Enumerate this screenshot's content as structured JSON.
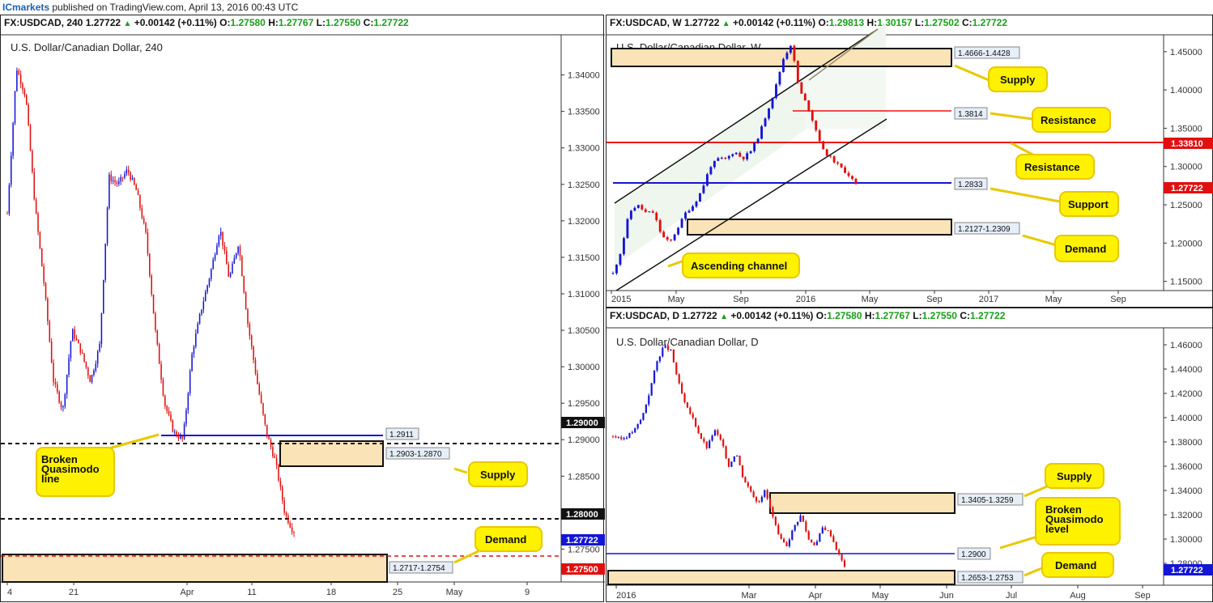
{
  "header": {
    "brand": "ICmarkets",
    "text": "published on TradingView.com, April 13, 2016 00:43 UTC"
  },
  "colors": {
    "bull": "#1515d6",
    "bear": "#e01010",
    "zone": "#fbe3b8",
    "callout": "#fff200",
    "trend": "#111111",
    "support_line": "#1515d6",
    "resistance_line": "#ee1111",
    "channel_fill": "#eef6ee"
  },
  "panels": {
    "h4": {
      "symbol": "FX:USDCAD, 240",
      "last": "1.27722",
      "change": "+0.00142 (+0.11%)",
      "o_label": "O:",
      "o": "1.27580",
      "h_label": "H:",
      "h": "1.27767",
      "l_label": "L:",
      "l": "1.27550",
      "c_label": "C:",
      "c": "1.27722",
      "subtitle": "U.S. Dollar/Canadian Dollar, 240",
      "price_axis": [
        "1.34000",
        "1.33500",
        "1.33000",
        "1.32500",
        "1.32000",
        "1.31500",
        "1.31000",
        "1.30500",
        "1.30000",
        "1.29500",
        "1.29000",
        "1.28500",
        "1.28000",
        "1.27500"
      ],
      "time_axis": [
        "4",
        "21",
        "Apr",
        "11",
        "18",
        "25",
        "May",
        "9"
      ],
      "price_tags": [
        "1.29000",
        "1.28000",
        "1.27722",
        "1.27500"
      ],
      "level_labels": [
        "1.2911",
        "1.2903-1.2870",
        "1.2717-1.2754"
      ],
      "callouts": [
        "Broken Quasimodo line",
        "Supply",
        "Demand"
      ]
    },
    "weekly": {
      "symbol": "FX:USDCAD, W",
      "last": "1.27722",
      "change": "+0.00142 (+0.11%)",
      "o_label": "O:",
      "o": "1.29813",
      "h_label": "H:",
      "h": "1.30157",
      "l_label": "L:",
      "l": "1.27502",
      "c_label": "C:",
      "c": "1.27722",
      "subtitle": "U.S. Dollar/Canadian Dollar, W",
      "price_axis": [
        "1.45000",
        "1.40000",
        "1.35000",
        "1.30000",
        "1.25000",
        "1.20000",
        "1.15000"
      ],
      "time_axis": [
        "2015",
        "May",
        "Sep",
        "2016",
        "May",
        "Sep",
        "2017",
        "May",
        "Sep"
      ],
      "price_tags": [
        "1.33810",
        "1.27722"
      ],
      "level_labels": [
        "1.4666-1.4428",
        "1.3814",
        "1.2833",
        "1.2127-1.2309"
      ],
      "callouts": [
        "Supply",
        "Resistance",
        "Resistance",
        "Support",
        "Demand",
        "Ascending channel"
      ]
    },
    "daily": {
      "symbol": "FX:USDCAD, D",
      "last": "1.27722",
      "change": "+0.00142 (+0.11%)",
      "o_label": "O:",
      "o": "1.27580",
      "h_label": "H:",
      "h": "1.27767",
      "l_label": "L:",
      "l": "1.27550",
      "c_label": "C:",
      "c": "1.27722",
      "subtitle": "U.S. Dollar/Canadian Dollar, D",
      "price_axis": [
        "1.46000",
        "1.44000",
        "1.42000",
        "1.40000",
        "1.38000",
        "1.36000",
        "1.34000",
        "1.32000",
        "1.30000",
        "1.28000"
      ],
      "time_axis": [
        "2016",
        "Mar",
        "Apr",
        "May",
        "Jun",
        "Jul",
        "Aug",
        "Sep"
      ],
      "price_tags": [
        "1.27722"
      ],
      "level_labels": [
        "1.3405-1.3259",
        "1.2900",
        "1.2653-1.2753"
      ],
      "callouts": [
        "Supply",
        "Broken Quasimodo level",
        "Demand"
      ]
    }
  },
  "chart_data": [
    {
      "type": "candlestick",
      "title": "U.S. Dollar/Canadian Dollar, 240",
      "ylim": [
        1.2705,
        1.3455
      ],
      "levels": {
        "broken_quasimodo_line": 1.2911,
        "round_number_upper": 1.29,
        "round_number_lower": 1.28,
        "dashed_red": 1.275
      },
      "zones": [
        {
          "name": "Supply",
          "range": [
            1.287,
            1.2903
          ]
        },
        {
          "name": "Demand",
          "range": [
            1.2717,
            1.2754
          ]
        }
      ],
      "series": [
        {
          "name": "USDCAD",
          "close_path": [
            1.321,
            1.341,
            1.337,
            1.322,
            1.311,
            1.298,
            1.294,
            1.305,
            1.302,
            1.298,
            1.303,
            1.326,
            1.325,
            1.327,
            1.324,
            1.318,
            1.305,
            1.295,
            1.291,
            1.29,
            1.302,
            1.308,
            1.313,
            1.319,
            1.312,
            1.317,
            1.306,
            1.298,
            1.291,
            1.287,
            1.28,
            1.2772
          ],
          "last": 1.27722,
          "open": 1.2758,
          "high": 1.27767,
          "low": 1.2755
        }
      ]
    },
    {
      "type": "candlestick",
      "title": "U.S. Dollar/Canadian Dollar, W",
      "ylim": [
        1.138,
        1.472
      ],
      "levels": {
        "resistance_upper": 1.3814,
        "resistance": 1.3381,
        "support": 1.2833
      },
      "zones": [
        {
          "name": "Supply",
          "range": [
            1.4428,
            1.4666
          ]
        },
        {
          "name": "Demand",
          "range": [
            1.2127,
            1.2309
          ]
        }
      ],
      "series": [
        {
          "name": "USDCAD",
          "close_path": [
            1.16,
            1.19,
            1.24,
            1.25,
            1.24,
            1.24,
            1.21,
            1.2,
            1.22,
            1.24,
            1.25,
            1.27,
            1.3,
            1.31,
            1.31,
            1.32,
            1.31,
            1.32,
            1.34,
            1.37,
            1.4,
            1.44,
            1.46,
            1.4,
            1.38,
            1.35,
            1.32,
            1.31,
            1.3,
            1.29,
            1.2772
          ],
          "last": 1.27722,
          "open": 1.29813,
          "high": 1.30157,
          "low": 1.27502
        }
      ]
    },
    {
      "type": "candlestick",
      "title": "U.S. Dollar/Canadian Dollar, D",
      "ylim": [
        1.262,
        1.474
      ],
      "levels": {
        "broken_quasimodo_level": 1.29
      },
      "zones": [
        {
          "name": "Supply",
          "range": [
            1.3259,
            1.3405
          ]
        },
        {
          "name": "Demand",
          "range": [
            1.2653,
            1.2753
          ]
        }
      ],
      "series": [
        {
          "name": "USDCAD",
          "close_path": [
            1.385,
            1.382,
            1.385,
            1.39,
            1.4,
            1.42,
            1.445,
            1.459,
            1.455,
            1.43,
            1.41,
            1.4,
            1.385,
            1.375,
            1.39,
            1.38,
            1.36,
            1.372,
            1.35,
            1.34,
            1.33,
            1.34,
            1.32,
            1.3,
            1.295,
            1.31,
            1.32,
            1.3,
            1.295,
            1.31,
            1.305,
            1.29,
            1.2772
          ],
          "last": 1.27722,
          "open": 1.2758,
          "high": 1.27767,
          "low": 1.2755
        }
      ]
    }
  ]
}
